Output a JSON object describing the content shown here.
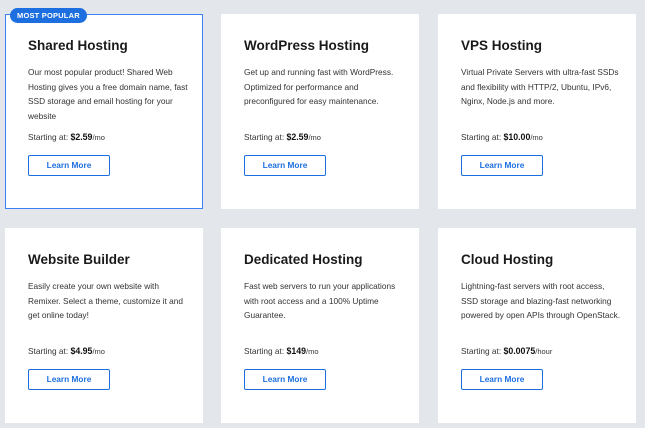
{
  "badge": "MOST POPULAR",
  "starting_label": "Starting at:",
  "cards": [
    {
      "title": "Shared Hosting",
      "description": "Our most popular product! Shared Web Hosting gives you a free domain name, fast SSD storage and email hosting for your website",
      "price": "$2.59",
      "unit": "/mo",
      "button": "Learn More"
    },
    {
      "title": "WordPress Hosting",
      "description": "Get up and running fast with WordPress. Optimized for performance and preconfigured for easy maintenance.",
      "price": "$2.59",
      "unit": "/mo",
      "button": "Learn More"
    },
    {
      "title": "VPS Hosting",
      "description": "Virtual Private Servers with ultra-fast SSDs and flexibility with HTTP/2, Ubuntu, IPv6, Nginx, Node.js and more.",
      "price": "$10.00",
      "unit": "/mo",
      "button": "Learn More"
    },
    {
      "title": "Website Builder",
      "description": "Easily create your own website with Remixer. Select a theme, customize it and get online today!",
      "price": "$4.95",
      "unit": "/mo",
      "button": "Learn More"
    },
    {
      "title": "Dedicated Hosting",
      "description": "Fast web servers to run your applications with root access and a 100% Uptime Guarantee.",
      "price": "$149",
      "unit": "/mo",
      "button": "Learn More"
    },
    {
      "title": "Cloud Hosting",
      "description": "Lightning-fast servers with root access, SSD storage and blazing-fast networking powered by open APIs through OpenStack.",
      "price": "$0.0075",
      "unit": "/hour",
      "button": "Learn More"
    }
  ],
  "colors": {
    "accent": "#1d6fe0",
    "background": "#e3e6ea",
    "card": "#ffffff"
  }
}
